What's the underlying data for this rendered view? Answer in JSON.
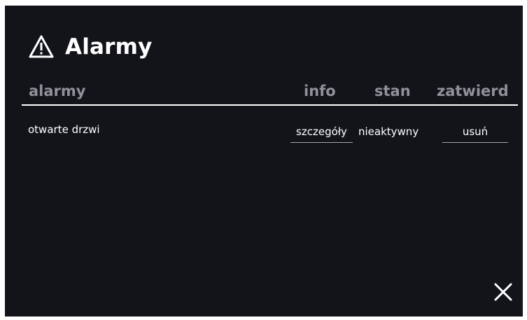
{
  "header": {
    "icon": "warning-triangle-icon",
    "title": "Alarmy"
  },
  "table": {
    "columns": {
      "alarmy": "alarmy",
      "info": "info",
      "stan": "stan",
      "zatwierd": "zatwierd"
    },
    "rows": [
      {
        "name": "otwarte drzwi",
        "info": "szczegóły",
        "stan": "nieaktywny",
        "action": "usuń"
      }
    ]
  },
  "footer": {
    "close_icon": "close-icon"
  },
  "colors": {
    "background": "#13141a",
    "header_text": "#8f9299",
    "text": "#ffffff"
  }
}
